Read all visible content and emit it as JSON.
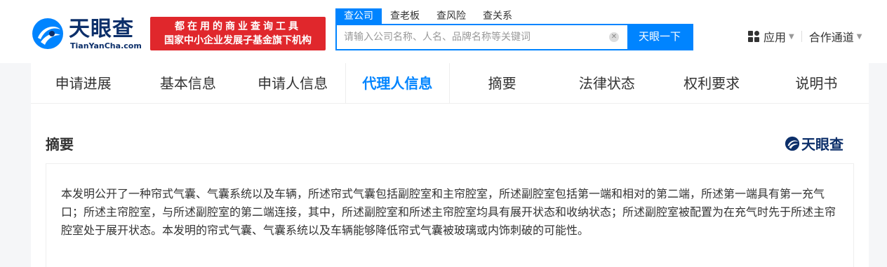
{
  "brand": {
    "name_cn": "天眼查",
    "name_en": "TianYanCha.com"
  },
  "promo": {
    "line1": "都在用的商业查询工具",
    "line2": "国家中小企业发展子基金旗下机构"
  },
  "search": {
    "tabs": [
      {
        "label": "查公司"
      },
      {
        "label": "查老板"
      },
      {
        "label": "查风险"
      },
      {
        "label": "查关系"
      }
    ],
    "placeholder": "请输入公司名称、人名、品牌名称等关键词",
    "button_label": "天眼一下"
  },
  "nav_right": {
    "apps_label": "应用",
    "partner_label": "合作通道"
  },
  "tabs": [
    {
      "label": "申请进展"
    },
    {
      "label": "基本信息"
    },
    {
      "label": "申请人信息"
    },
    {
      "label": "代理人信息"
    },
    {
      "label": "摘要"
    },
    {
      "label": "法律状态"
    },
    {
      "label": "权利要求"
    },
    {
      "label": "说明书"
    }
  ],
  "active_tab": "代理人信息",
  "section": {
    "title": "摘要",
    "watermark": "天眼查"
  },
  "abstract": {
    "text": "本发明公开了一种帘式气囊、气囊系统以及车辆，所述帘式气囊包括副腔室和主帘腔室，所述副腔室包括第一端和相对的第二端，所述第一端具有第一充气口；所述主帘腔室，与所述副腔室的第二端连接，其中，所述副腔室和所述主帘腔室均具有展开状态和收纳状态；所述副腔室被配置为在充气时先于所述主帘腔室处于展开状态。本发明的帘式气囊、气囊系统以及车辆能够降低帘式气囊被玻璃或内饰刺破的可能性。"
  },
  "colors": {
    "accent": "#0084ff",
    "brand": "#0c2f6a",
    "promo": "#e0272c"
  }
}
